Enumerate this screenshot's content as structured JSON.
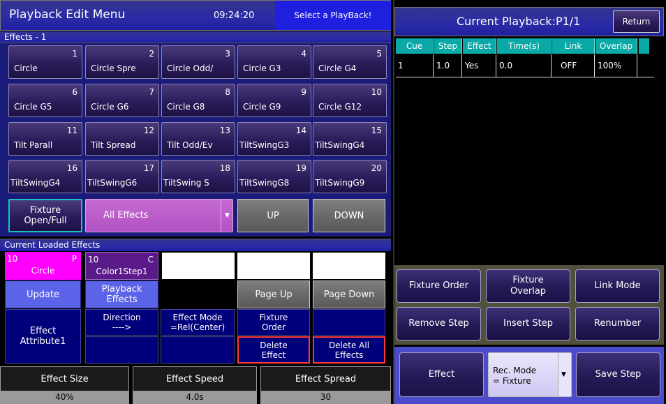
{
  "header": {
    "title": "Playback Edit Menu",
    "time": "09:24:20",
    "notice": "Select a PlayBack!"
  },
  "effects": {
    "section_title": "Effects - 1",
    "items": [
      {
        "num": "1",
        "label": "Circle"
      },
      {
        "num": "2",
        "label": "Circle Spre"
      },
      {
        "num": "3",
        "label": "Circle Odd/"
      },
      {
        "num": "4",
        "label": "Circle G3"
      },
      {
        "num": "5",
        "label": "Circle G4"
      },
      {
        "num": "6",
        "label": "Circle G5"
      },
      {
        "num": "7",
        "label": "Circle G6"
      },
      {
        "num": "8",
        "label": "Circle G8"
      },
      {
        "num": "9",
        "label": "Circle G9"
      },
      {
        "num": "10",
        "label": "Circle G12"
      },
      {
        "num": "11",
        "label": "Tilt Parall"
      },
      {
        "num": "12",
        "label": "Tilt Spread"
      },
      {
        "num": "13",
        "label": "Tilt Odd/Ev"
      },
      {
        "num": "14",
        "label": "TiltSwingG3"
      },
      {
        "num": "15",
        "label": "TiltSwingG4"
      },
      {
        "num": "16",
        "label": "TiltSwingG4"
      },
      {
        "num": "17",
        "label": "TiltSwingG6"
      },
      {
        "num": "18",
        "label": "TiltSwing S"
      },
      {
        "num": "19",
        "label": "TiltSwingG8"
      },
      {
        "num": "20",
        "label": "TiltSwingG9"
      }
    ]
  },
  "controls": {
    "fixture_l1": "Fixture",
    "fixture_l2": "Open/Full",
    "filter": "All Effects",
    "up": "UP",
    "down": "DOWN"
  },
  "loaded": {
    "section_title": "Current Loaded Effects",
    "slot1": {
      "num": "10",
      "tag": "P",
      "name": "Circle"
    },
    "slot2": {
      "num": "10",
      "tag": "C",
      "name": "Color1Step1"
    },
    "update": "Update",
    "pb_effects_l1": "Playback",
    "pb_effects_l2": "Effects",
    "page_up": "Page Up",
    "page_down": "Page Down",
    "effect_attr_l1": "Effect",
    "effect_attr_l2": "Attribute1",
    "direction_l1": "Direction",
    "direction_l2": "---->",
    "mode_l1": "Effect Mode",
    "mode_l2": "=Rel(Center)",
    "fixture_order_l1": "Fixture",
    "fixture_order_l2": "Order",
    "delete_l1": "Delete",
    "delete_l2": "Effect",
    "delete_all_l1": "Delete All",
    "delete_all_l2": "Effects"
  },
  "params": {
    "size_label": "Effect Size",
    "size_value": "40%",
    "speed_label": "Effect Speed",
    "speed_value": "4.0s",
    "spread_label": "Effect Spread",
    "spread_value": "30"
  },
  "playback": {
    "title": "Current Playback:P1/1",
    "return": "Return",
    "columns": [
      "Cue",
      "Step",
      "Effect",
      "Time(s)",
      "Link",
      "Overlap"
    ],
    "rows": [
      [
        "1",
        "1.0",
        "Yes",
        "0.0",
        "OFF",
        "100%"
      ]
    ]
  },
  "right_buttons": {
    "fixture_order": "Fixture Order",
    "fixture_overlap_l1": "Fixture",
    "fixture_overlap_l2": "Overlap",
    "link_mode": "Link Mode",
    "remove_step": "Remove Step",
    "insert_step": "Insert Step",
    "renumber": "Renumber",
    "effect": "Effect",
    "rec_mode_l1": "Rec. Mode",
    "rec_mode_l2": "= Fixture",
    "save_step": "Save Step"
  },
  "colors": {
    "accent_teal": "#0aa8a6",
    "highlight_magenta": "#ff00ff",
    "header_blue": "#2a2ba6"
  }
}
